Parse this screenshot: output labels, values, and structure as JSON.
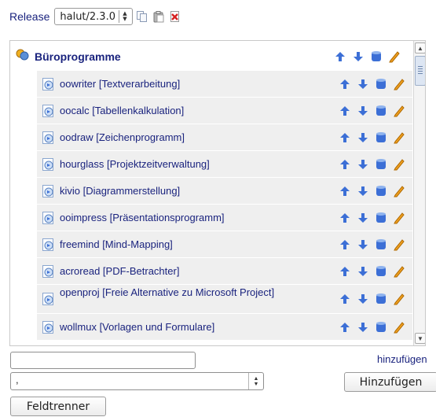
{
  "release": {
    "label": "Release",
    "selected": "halut/2.3.0"
  },
  "group": {
    "label": "Büroprogramme"
  },
  "items": [
    {
      "label": "oowriter [Textverarbeitung]"
    },
    {
      "label": "oocalc [Tabellenkalkulation]"
    },
    {
      "label": "oodraw [Zeichenprogramm]"
    },
    {
      "label": "hourglass [Projektzeitverwaltung]"
    },
    {
      "label": "kivio [Diagrammerstellung]"
    },
    {
      "label": "ooimpress [Präsentationsprogramm]"
    },
    {
      "label": "freemind [Mind-Mapping]"
    },
    {
      "label": "acroread [PDF-Betrachter]"
    },
    {
      "label": "openproj [Freie Alternative zu Microsoft Project]"
    },
    {
      "label": "wollmux [Vorlagen und Formulare]"
    }
  ],
  "form": {
    "new_value": "",
    "add_link": "hinzufügen",
    "separator_value": ",",
    "add_button": "Hinzufügen",
    "separator_button": "Feldtrenner"
  },
  "colors": {
    "text": "#1a237e",
    "row_bg": "#efefef",
    "arrow_blue": "#3c6fd6",
    "edit_orange": "#f0a020",
    "delete_red": "#d62020"
  }
}
